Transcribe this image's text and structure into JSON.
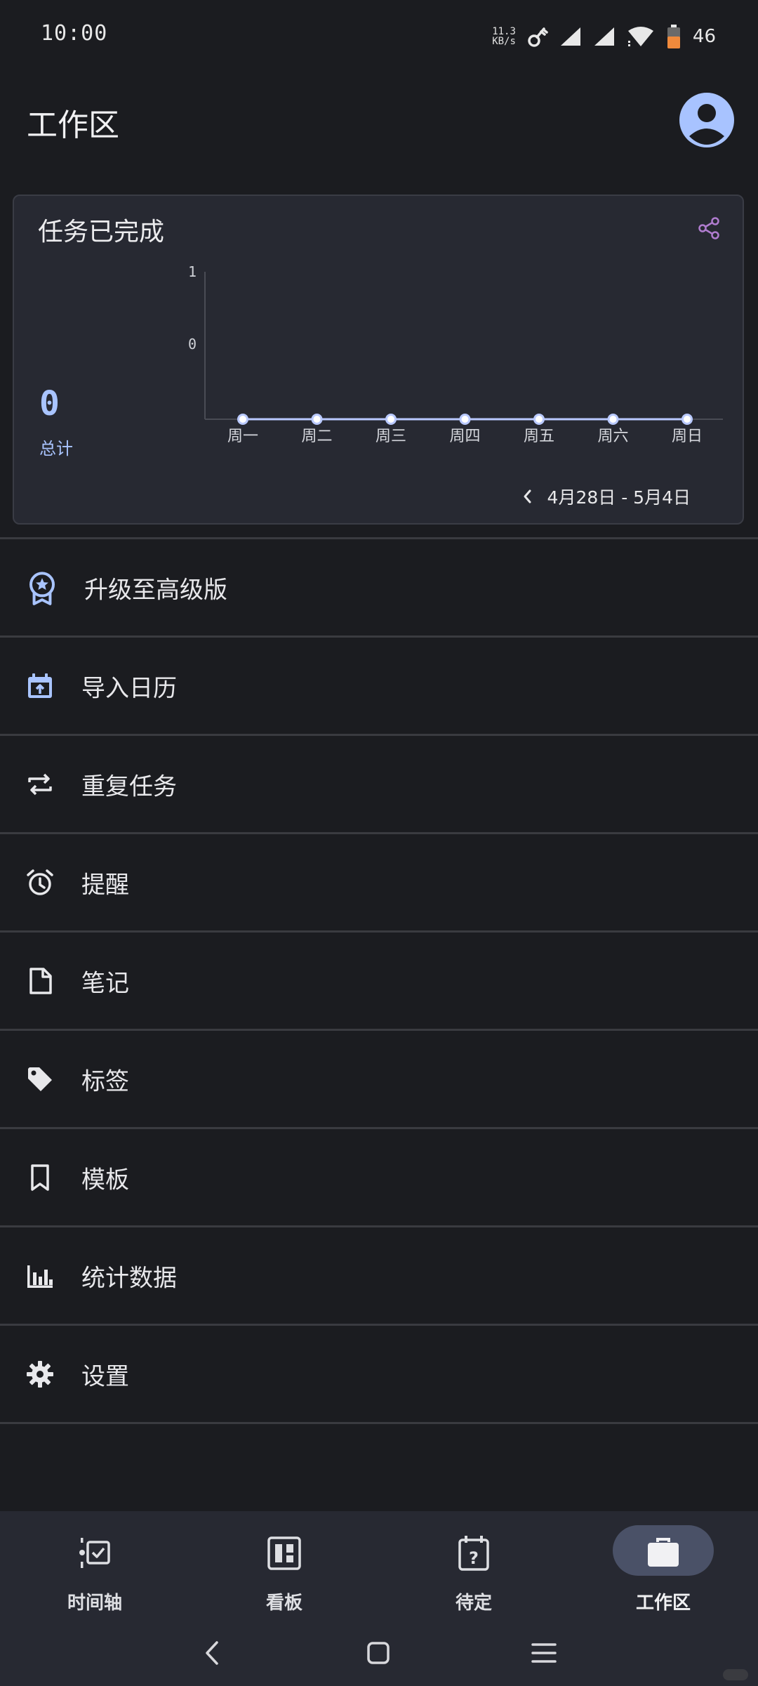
{
  "status_bar": {
    "time": "10:00",
    "net_speed_value": "11.3",
    "net_speed_unit": "KB/s",
    "battery_level": "46",
    "icons": [
      "key-icon",
      "signal-icon",
      "signal-icon",
      "wifi-icon",
      "battery-icon"
    ]
  },
  "header": {
    "title": "工作区",
    "avatar_icon": "account-circle-icon"
  },
  "stats_card": {
    "title": "任务已完成",
    "share_icon": "share-icon",
    "total_value": "0",
    "total_label": "总计",
    "date_range": "4月28日 - 5月4日",
    "prev_icon": "chevron-left-icon"
  },
  "chart_data": {
    "type": "line",
    "categories": [
      "周一",
      "周二",
      "周三",
      "周四",
      "周五",
      "周六",
      "周日"
    ],
    "values": [
      0,
      0,
      0,
      0,
      0,
      0,
      0
    ],
    "y_ticks": [
      "1",
      "0"
    ],
    "title": "",
    "xlabel": "",
    "ylabel": "",
    "line_color": "#b9c9ff"
  },
  "menu": {
    "items": [
      {
        "label": "升级至高级版",
        "icon": "award-badge-icon"
      },
      {
        "label": "导入日历",
        "icon": "calendar-import-icon"
      },
      {
        "label": "重复任务",
        "icon": "repeat-icon"
      },
      {
        "label": "提醒",
        "icon": "alarm-icon"
      },
      {
        "label": "笔记",
        "icon": "note-icon"
      },
      {
        "label": "标签",
        "icon": "tag-icon"
      },
      {
        "label": "模板",
        "icon": "bookmark-icon"
      },
      {
        "label": "统计数据",
        "icon": "bar-chart-icon"
      },
      {
        "label": "设置",
        "icon": "gear-icon"
      }
    ]
  },
  "bottom_nav": {
    "tabs": [
      {
        "label": "时间轴",
        "icon": "timeline-icon"
      },
      {
        "label": "看板",
        "icon": "board-icon"
      },
      {
        "label": "待定",
        "icon": "calendar-question-icon"
      },
      {
        "label": "工作区",
        "icon": "briefcase-icon",
        "active": true
      }
    ]
  },
  "colors": {
    "background": "#1b1c20",
    "card": "#272932",
    "accent": "#a9c4ff",
    "share": "#b07ccf",
    "battery": "#f08a3c",
    "active_pill": "#4a5167"
  }
}
